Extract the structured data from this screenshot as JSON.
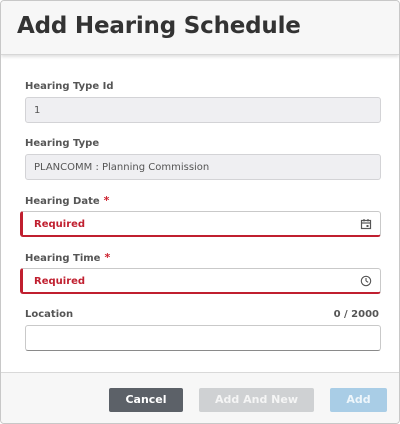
{
  "dialog": {
    "title": "Add Hearing Schedule"
  },
  "fields": {
    "hearing_type_id": {
      "label": "Hearing Type Id",
      "value": "1"
    },
    "hearing_type": {
      "label": "Hearing Type",
      "value": "PLANCOMM : Planning Commission"
    },
    "hearing_date": {
      "label": "Hearing Date",
      "required_mark": "*",
      "error_text": "Required",
      "icon": "calendar-icon"
    },
    "hearing_time": {
      "label": "Hearing Time",
      "required_mark": "*",
      "error_text": "Required",
      "icon": "clock-icon"
    },
    "location": {
      "label": "Location",
      "counter": "0 / 2000",
      "value": ""
    }
  },
  "footer": {
    "cancel_label": "Cancel",
    "add_and_new_label": "Add And New",
    "add_label": "Add"
  },
  "colors": {
    "error": "#c01f2f",
    "cancel_button": "#5c6168",
    "disabled_button": "#cfd1d3",
    "primary_disabled": "#a9cde6"
  }
}
